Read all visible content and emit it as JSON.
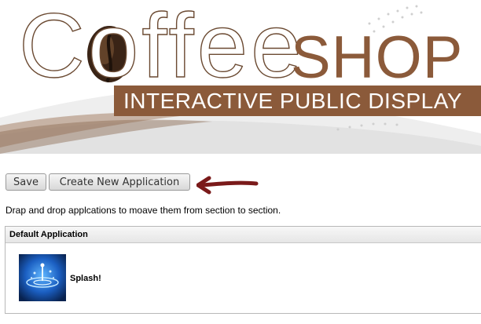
{
  "branding": {
    "logo_word_1": "Coffee",
    "logo_word_2": "SHOP",
    "tagline": "INTERACTIVE PUBLIC DISPLAY",
    "colors": {
      "brand_brown": "#8b5a3a",
      "outline_brown": "#6b4a32",
      "arrow_red": "#7a1a1a"
    }
  },
  "toolbar": {
    "save_label": "Save",
    "create_label": "Create New Application"
  },
  "instructions": "Drap and drop applcations to moave them from section to section.",
  "sections": [
    {
      "title": "Default Application",
      "apps": [
        {
          "name": "Splash!",
          "icon": "water-splash-thumbnail"
        }
      ]
    }
  ]
}
